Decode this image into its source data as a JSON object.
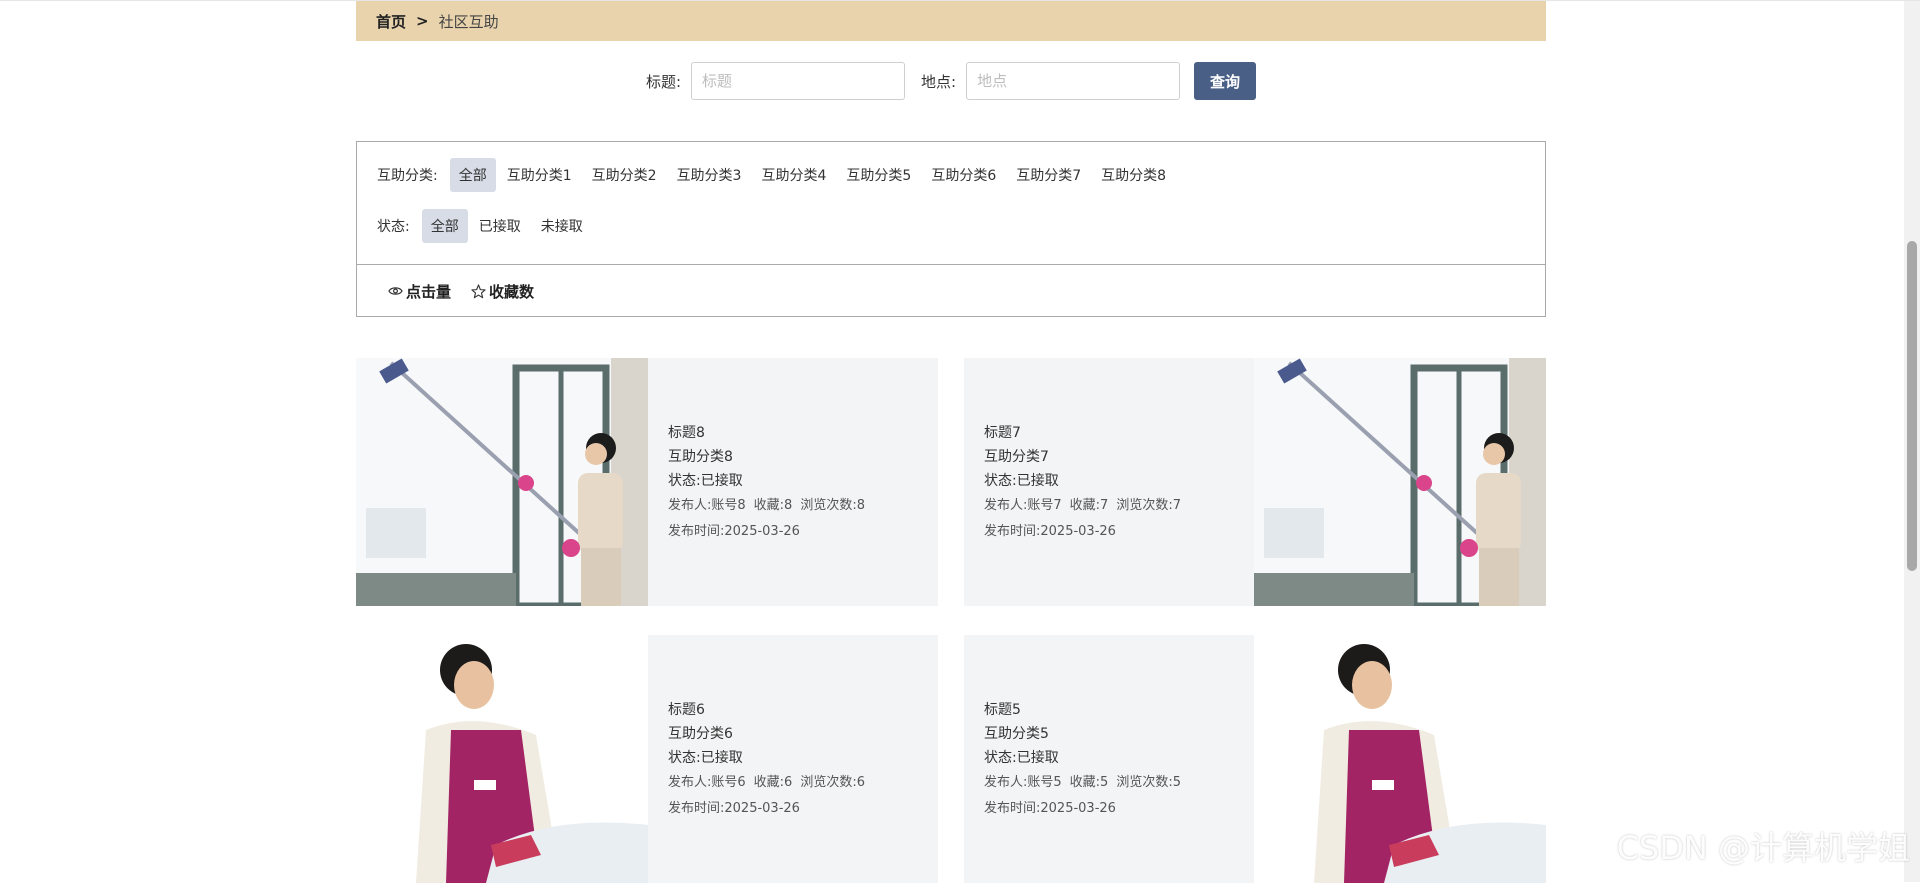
{
  "breadcrumb": {
    "home": "首页",
    "separator": ">",
    "current": "社区互助"
  },
  "search": {
    "title_label": "标题:",
    "title_placeholder": "标题",
    "location_label": "地点:",
    "location_placeholder": "地点",
    "button": "查询"
  },
  "filters": {
    "category_label": "互助分类:",
    "categories": [
      "全部",
      "互助分类1",
      "互助分类2",
      "互助分类3",
      "互助分类4",
      "互助分类5",
      "互助分类6",
      "互助分类7",
      "互助分类8"
    ],
    "category_selected": "全部",
    "status_label": "状态:",
    "statuses": [
      "全部",
      "已接取",
      "未接取"
    ],
    "status_selected": "全部"
  },
  "sort": {
    "clicks": "点击量",
    "favorites": "收藏数"
  },
  "cards": [
    {
      "title": "标题8",
      "category": "互助分类8",
      "status": "状态:已接取",
      "publisher": "发布人:账号8",
      "favorites": "收藏:8",
      "views": "浏览次数:8",
      "time": "发布时间:2025-03-26",
      "image": "window-cleaning-photo"
    },
    {
      "title": "标题7",
      "category": "互助分类7",
      "status": "状态:已接取",
      "publisher": "发布人:账号7",
      "favorites": "收藏:7",
      "views": "浏览次数:7",
      "time": "发布时间:2025-03-26",
      "image": "window-cleaning-photo"
    },
    {
      "title": "标题6",
      "category": "互助分类6",
      "status": "状态:已接取",
      "publisher": "发布人:账号6",
      "favorites": "收藏:6",
      "views": "浏览次数:6",
      "time": "发布时间:2025-03-26",
      "image": "ironing-photo"
    },
    {
      "title": "标题5",
      "category": "互助分类5",
      "status": "状态:已接取",
      "publisher": "发布人:账号5",
      "favorites": "收藏:5",
      "views": "浏览次数:5",
      "time": "发布时间:2025-03-26",
      "image": "ironing-photo"
    }
  ],
  "watermark": "CSDN @计算机学姐",
  "colors": {
    "breadcrumb_bg": "#e8d3ad",
    "button_bg": "#4a5f86",
    "card_bg": "#f3f4f6",
    "chip_active": "#d7dce6"
  }
}
